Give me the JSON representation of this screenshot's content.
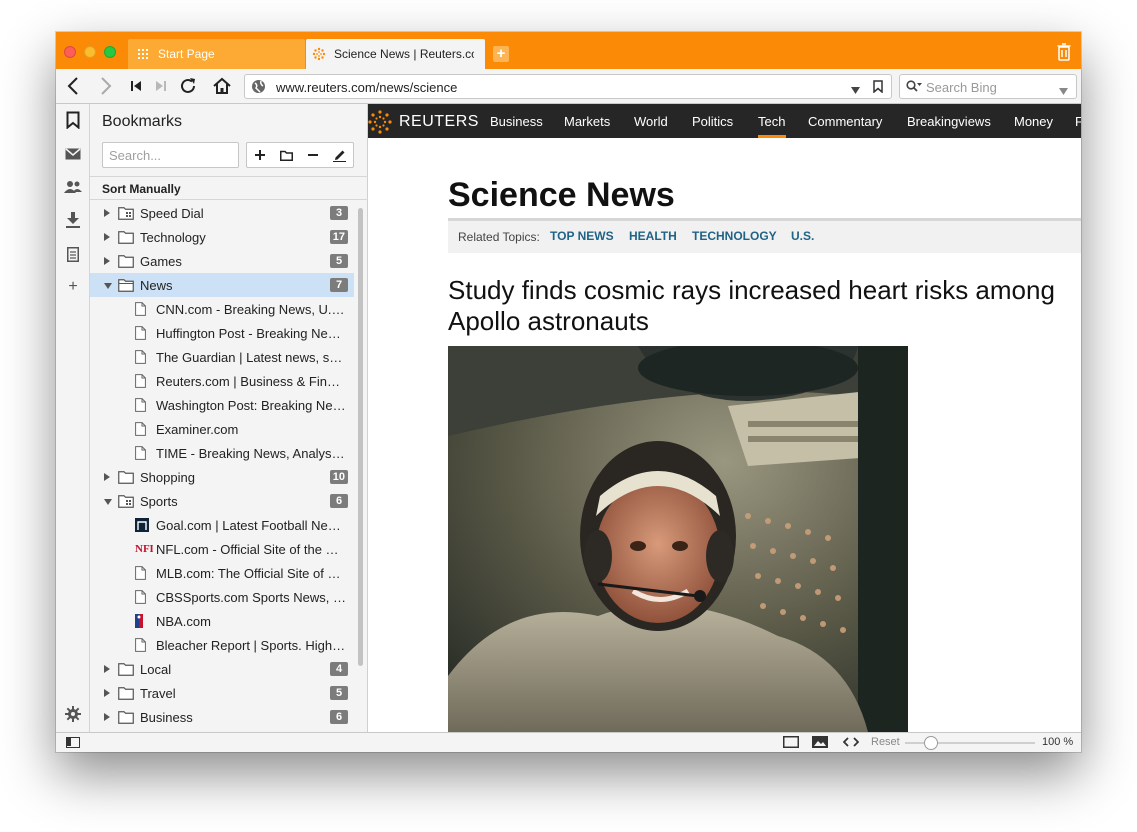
{
  "tabs": {
    "start_label": "Start Page",
    "active_label": "Science News | Reuters.com"
  },
  "address": {
    "url": "www.reuters.com/news/science",
    "search_placeholder": "Search Bing"
  },
  "bookmarks": {
    "title": "Bookmarks",
    "search_placeholder": "Search...",
    "sort_label": "Sort Manually",
    "items": [
      {
        "type": "folder",
        "label": "Speed Dial",
        "count": "3",
        "open": false,
        "icon": "speed-dial-icon"
      },
      {
        "type": "folder",
        "label": "Technology",
        "count": "17",
        "open": false,
        "icon": "folder-icon"
      },
      {
        "type": "folder",
        "label": "Games",
        "count": "5",
        "open": false,
        "icon": "folder-icon"
      },
      {
        "type": "folder",
        "label": "News",
        "count": "7",
        "open": true,
        "selected": true,
        "icon": "folder-open-icon"
      },
      {
        "type": "bookmark",
        "label": "CNN.com - Breaking News, U.S....",
        "icon": "page-icon"
      },
      {
        "type": "bookmark",
        "label": "Huffington Post - Breaking New...",
        "icon": "page-icon"
      },
      {
        "type": "bookmark",
        "label": "The Guardian | Latest news, spo...",
        "icon": "page-icon"
      },
      {
        "type": "bookmark",
        "label": "Reuters.com | Business & Finan...",
        "icon": "page-icon"
      },
      {
        "type": "bookmark",
        "label": "Washington Post: Breaking New...",
        "icon": "page-icon"
      },
      {
        "type": "bookmark",
        "label": "Examiner.com",
        "icon": "page-icon"
      },
      {
        "type": "bookmark",
        "label": "TIME - Breaking News, Analysis,...",
        "icon": "page-icon"
      },
      {
        "type": "folder",
        "label": "Shopping",
        "count": "10",
        "open": false,
        "icon": "folder-icon"
      },
      {
        "type": "folder",
        "label": "Sports",
        "count": "6",
        "open": true,
        "icon": "speed-dial-icon"
      },
      {
        "type": "bookmark",
        "label": "Goal.com | Latest Football News...",
        "icon": "goal-favicon"
      },
      {
        "type": "bookmark",
        "label": "NFL.com - Official Site of the Na...",
        "icon": "nfl-favicon"
      },
      {
        "type": "bookmark",
        "label": "MLB.com: The Official Site of M...",
        "icon": "page-icon"
      },
      {
        "type": "bookmark",
        "label": "CBSSports.com Sports News, F...",
        "icon": "page-icon"
      },
      {
        "type": "bookmark",
        "label": "NBA.com",
        "icon": "nba-favicon"
      },
      {
        "type": "bookmark",
        "label": "Bleacher Report | Sports. Highlig...",
        "icon": "page-icon"
      },
      {
        "type": "folder",
        "label": "Local",
        "count": "4",
        "open": false,
        "icon": "folder-icon"
      },
      {
        "type": "folder",
        "label": "Travel",
        "count": "5",
        "open": false,
        "icon": "folder-icon"
      },
      {
        "type": "folder",
        "label": "Business",
        "count": "6",
        "open": false,
        "icon": "folder-icon"
      }
    ]
  },
  "site": {
    "brand": "REUTERS",
    "nav": [
      "Business",
      "Markets",
      "World",
      "Politics",
      "Tech",
      "Commentary",
      "Breakingviews",
      "Money",
      "F"
    ],
    "active_nav": "Tech",
    "page_title": "Science News",
    "related_label": "Related Topics:",
    "topics": [
      "TOP NEWS",
      "HEALTH",
      "TECHNOLOGY",
      "U.S."
    ],
    "headline": "Study finds cosmic rays increased heart risks among Apollo astronauts"
  },
  "status": {
    "reset_label": "Reset",
    "zoom": "100 %",
    "zoom_fraction": 0.2
  },
  "colors": {
    "accent": "#fb8a07",
    "selection": "#cde1f6",
    "reuters_bar": "#262626",
    "topic_link": "#1f6386"
  }
}
